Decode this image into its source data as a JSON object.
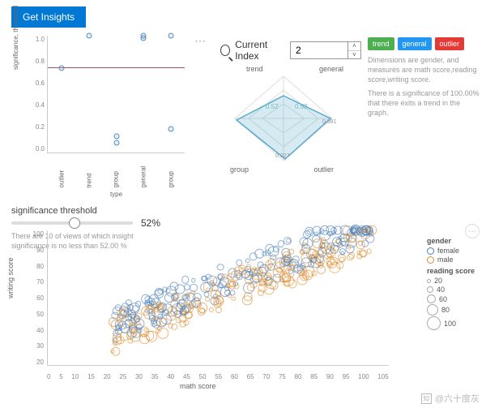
{
  "buttons": {
    "get_insights": "Get Insights"
  },
  "index": {
    "label": "Current Index",
    "value": "2"
  },
  "tags": [
    {
      "label": "trend",
      "color": "#4caf50"
    },
    {
      "label": "general",
      "color": "#2196f3"
    },
    {
      "label": "outlier",
      "color": "#e53935"
    }
  ],
  "info": {
    "line1": "Dimensions are gender, and measures are math score,reading score,writing score.",
    "line2": "There is a significance of 100.00% that there exits a trend in the graph."
  },
  "slider": {
    "title": "significance threshold",
    "value_pct": 52,
    "value_label": "52%",
    "desc": "There are 10 of views of which insight significance is no less than 52.00 %"
  },
  "scatter_legend": {
    "gender_title": "gender",
    "genders": [
      {
        "label": "female",
        "color": "#4a7fb8"
      },
      {
        "label": "male",
        "color": "#e08b2c"
      }
    ],
    "size_title": "reading score",
    "sizes": [
      20,
      40,
      60,
      80,
      100
    ]
  },
  "watermark": "@六十度灰",
  "chart_data": [
    {
      "type": "scatter",
      "name": "significance_threshold_chart",
      "xlabel": "type",
      "ylabel": "significance, threshold",
      "ylim": [
        0,
        1.0
      ],
      "yticks": [
        0.0,
        0.2,
        0.4,
        0.6,
        0.8,
        1.0
      ],
      "categories": [
        "outlier",
        "trend",
        "group",
        "general",
        "group"
      ],
      "values": [
        0.72,
        1.0,
        0.14,
        1.0,
        1.0
      ],
      "secondary_values": [
        null,
        null,
        0.08,
        0.98,
        0.2
      ],
      "reference_line": 0.72
    },
    {
      "type": "radar",
      "name": "radar_chart",
      "axes": [
        "trend",
        "general",
        "outlier",
        "group"
      ],
      "series": [
        {
          "name": "sig",
          "values": [
            0.52,
            0.981,
            0.027,
            0.027
          ]
        }
      ],
      "annotations": [
        "0.52",
        "0.981",
        "0.027",
        "0.52"
      ]
    },
    {
      "type": "scatter",
      "name": "main_scatter",
      "xlabel": "math score",
      "ylabel": "writing score",
      "xlim": [
        0,
        105
      ],
      "ylim": [
        0,
        100
      ],
      "xticks": [
        0,
        5,
        10,
        15,
        20,
        25,
        30,
        35,
        40,
        45,
        50,
        55,
        60,
        65,
        70,
        75,
        80,
        85,
        90,
        95,
        100,
        105
      ],
      "yticks": [
        20,
        30,
        40,
        50,
        60,
        70,
        80,
        90,
        100
      ],
      "size_encodes": "reading score",
      "color_encodes": "gender",
      "note": "Dense bubble scatter; female (blue) cluster skews slightly higher writing for same math, male (orange) slightly lower. Strong positive correlation."
    }
  ]
}
